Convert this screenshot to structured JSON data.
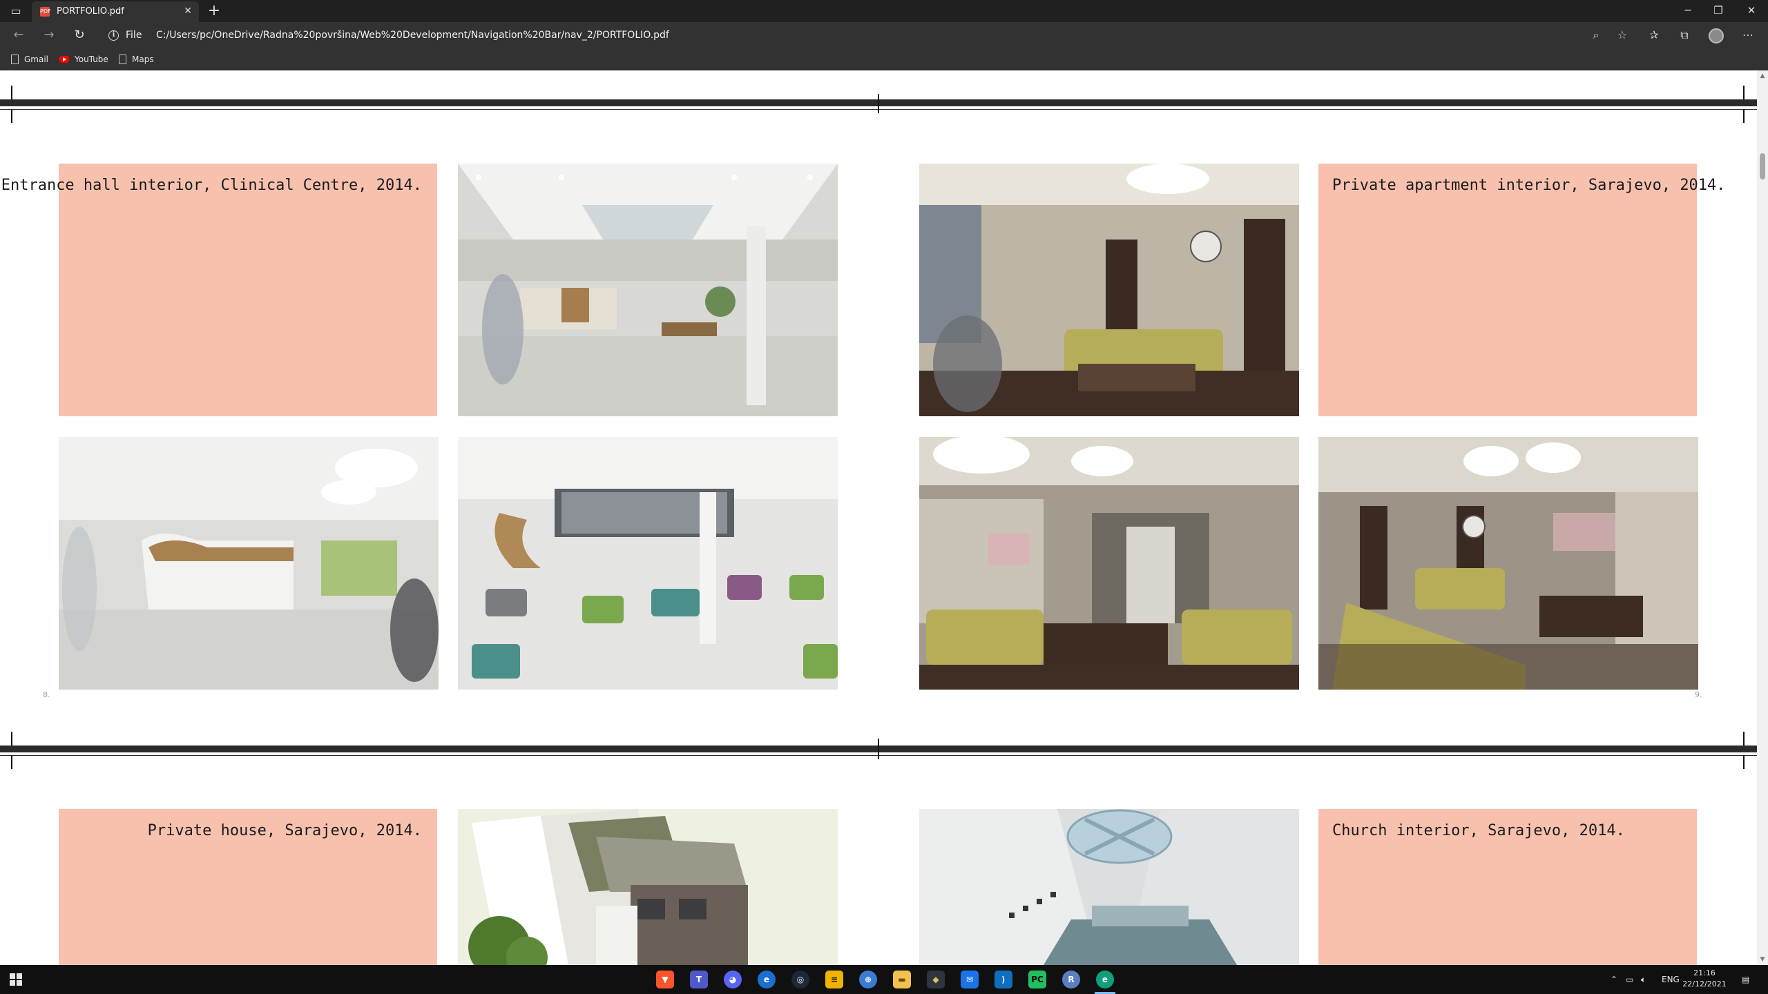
{
  "browser": {
    "tab_title": "PORTFOLIO.pdf",
    "tab_icon_text": "PDF",
    "file_label": "File",
    "url": "C:/Users/pc/OneDrive/Radna%20površina/Web%20Development/Navigation%20Bar/nav_2/PORTFOLIO.pdf",
    "bookmarks": [
      "Gmail",
      "YouTube",
      "Maps"
    ]
  },
  "pdf": {
    "captions": {
      "entrance": "Entrance hall interior, Clinical Centre, 2014.",
      "apartment": "Private apartment interior, Sarajevo, 2014.",
      "house": "Private house, Sarajevo, 2014.",
      "church": "Church interior, Sarajevo, 2014."
    },
    "page_numbers": {
      "left": "8.",
      "right": "9."
    },
    "accent_color": "#f7c1ae"
  },
  "taskbar": {
    "apps": [
      "brave-icon",
      "teams-icon",
      "discord-icon",
      "edge-dev-icon",
      "steam-icon",
      "ableton-icon",
      "vpn-icon",
      "file-explorer-icon",
      "sourcetree-icon",
      "mail-icon",
      "vscode-icon",
      "pycharm-icon",
      "r-icon",
      "edge-icon"
    ],
    "language": "ENG",
    "time": "21:16",
    "date": "22/12/2021"
  }
}
